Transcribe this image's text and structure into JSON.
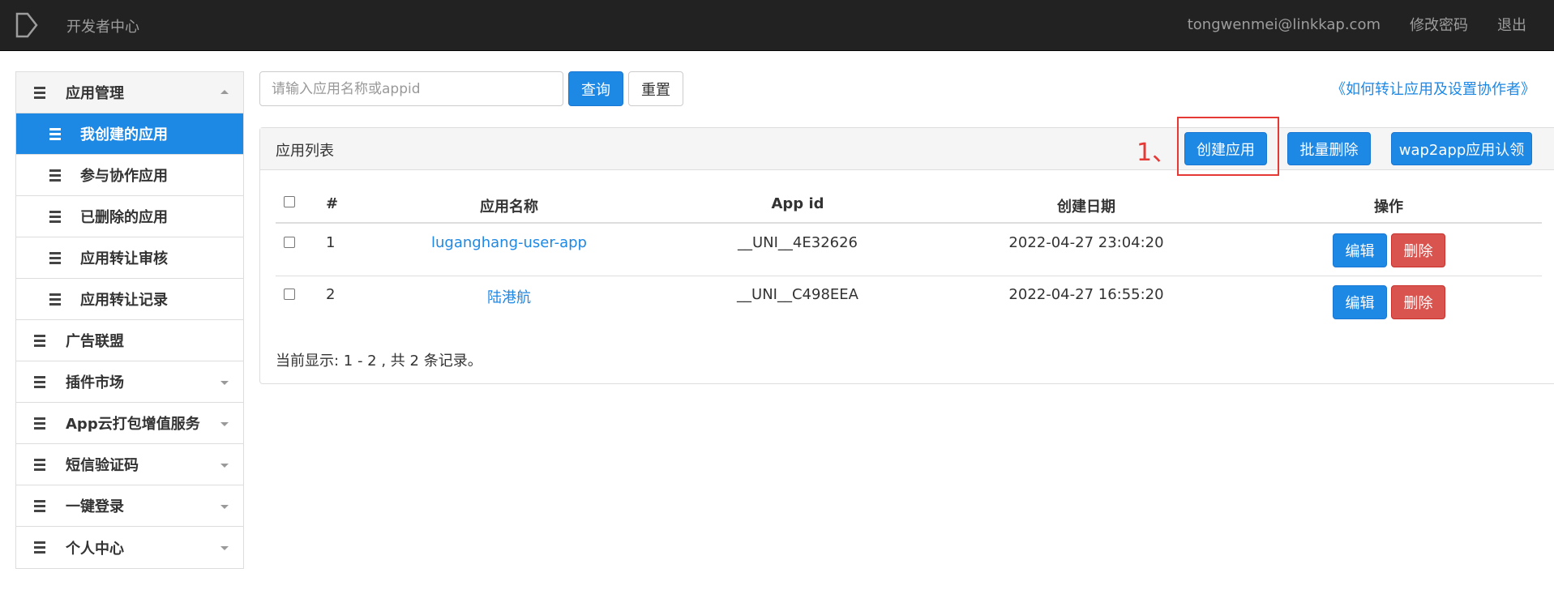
{
  "topbar": {
    "brand": "开发者中心",
    "user_email": "tongwenmei@linkkap.com",
    "change_password": "修改密码",
    "logout": "退出"
  },
  "sidebar": {
    "app_management": "应用管理",
    "sub_items": [
      "我创建的应用",
      "参与协作应用",
      "已删除的应用",
      "应用转让审核",
      "应用转让记录"
    ],
    "ad_alliance": "广告联盟",
    "plugin_market": "插件市场",
    "app_cloud_pack": "App云打包增值服务",
    "sms_verify": "短信验证码",
    "one_click_login": "一键登录",
    "personal_center": "个人中心"
  },
  "search": {
    "placeholder": "请输入应用名称或appid",
    "query_label": "查询",
    "reset_label": "重置"
  },
  "help_link": "《如何转让应用及设置协作者》",
  "panel": {
    "title": "应用列表",
    "step_marker": "1、",
    "create_label": "创建应用",
    "batch_delete_label": "批量删除",
    "wap2app_label": "wap2app应用认领"
  },
  "table": {
    "headers": {
      "index": "#",
      "name": "应用名称",
      "appid": "App id",
      "created": "创建日期",
      "actions": "操作"
    },
    "rows": [
      {
        "index": "1",
        "name": "luganghang-user-app",
        "appid": "__UNI__4E32626",
        "created": "2022-04-27 23:04:20",
        "edit": "编辑",
        "delete": "删除"
      },
      {
        "index": "2",
        "name": "陆港航",
        "appid": "__UNI__C498EEA",
        "created": "2022-04-27 16:55:20",
        "edit": "编辑",
        "delete": "删除"
      }
    ],
    "summary": "当前显示: 1 - 2 , 共 2 条记录。"
  },
  "colors": {
    "primary": "#1e88e5",
    "danger": "#d9534f",
    "topbar": "#222222",
    "highlight": "#e53935"
  }
}
